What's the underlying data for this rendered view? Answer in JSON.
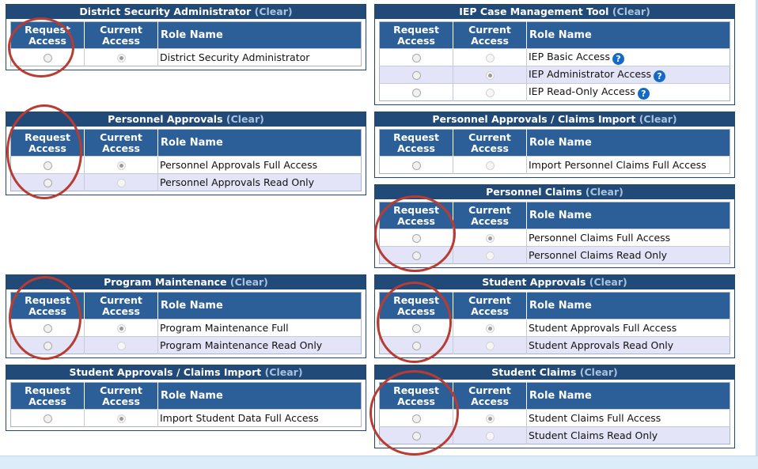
{
  "clear_label": "(Clear)",
  "headers": {
    "request": "Request Access",
    "current": "Current Access",
    "role": "Role Name"
  },
  "panels": [
    {
      "title": "District Security Administrator",
      "roles": [
        {
          "name": "District Security Administrator",
          "current": true,
          "help": false
        }
      ]
    },
    {
      "title": "IEP Case Management Tool",
      "roles": [
        {
          "name": "IEP Basic Access",
          "current": false,
          "help": true
        },
        {
          "name": "IEP Administrator Access",
          "current": true,
          "help": true
        },
        {
          "name": "IEP Read-Only Access",
          "current": false,
          "help": true
        }
      ]
    },
    {
      "title": "Personnel Approvals",
      "roles": [
        {
          "name": "Personnel Approvals Full Access",
          "current": true,
          "help": false
        },
        {
          "name": "Personnel Approvals Read Only",
          "current": false,
          "help": false
        }
      ]
    },
    {
      "title": "Personnel Approvals / Claims Import",
      "roles": [
        {
          "name": "Import Personnel Claims Full Access",
          "current": false,
          "help": false
        }
      ]
    },
    {
      "title": "Personnel Claims",
      "roles": [
        {
          "name": "Personnel Claims Full Access",
          "current": true,
          "help": false
        },
        {
          "name": "Personnel Claims Read Only",
          "current": false,
          "help": false
        }
      ]
    },
    {
      "title": "Program Maintenance",
      "roles": [
        {
          "name": "Program Maintenance Full",
          "current": true,
          "help": false
        },
        {
          "name": "Program Maintenance Read Only",
          "current": false,
          "help": false
        }
      ]
    },
    {
      "title": "Student Approvals",
      "roles": [
        {
          "name": "Student Approvals Full Access",
          "current": true,
          "help": false
        },
        {
          "name": "Student Approvals Read Only",
          "current": false,
          "help": false
        }
      ]
    },
    {
      "title": "Student Approvals / Claims Import",
      "roles": [
        {
          "name": "Import Student Data Full Access",
          "current": true,
          "help": false
        }
      ]
    },
    {
      "title": "Student Claims",
      "roles": [
        {
          "name": "Student Claims Full Access",
          "current": true,
          "help": false
        },
        {
          "name": "Student Claims Read Only",
          "current": false,
          "help": false
        }
      ]
    }
  ],
  "colors": {
    "panel_title_bg": "#224a78",
    "header_bg": "#2c5f97",
    "alt_row": "#e4e4f8",
    "annotation": "#b83c32",
    "help_icon": "#1569c7"
  }
}
